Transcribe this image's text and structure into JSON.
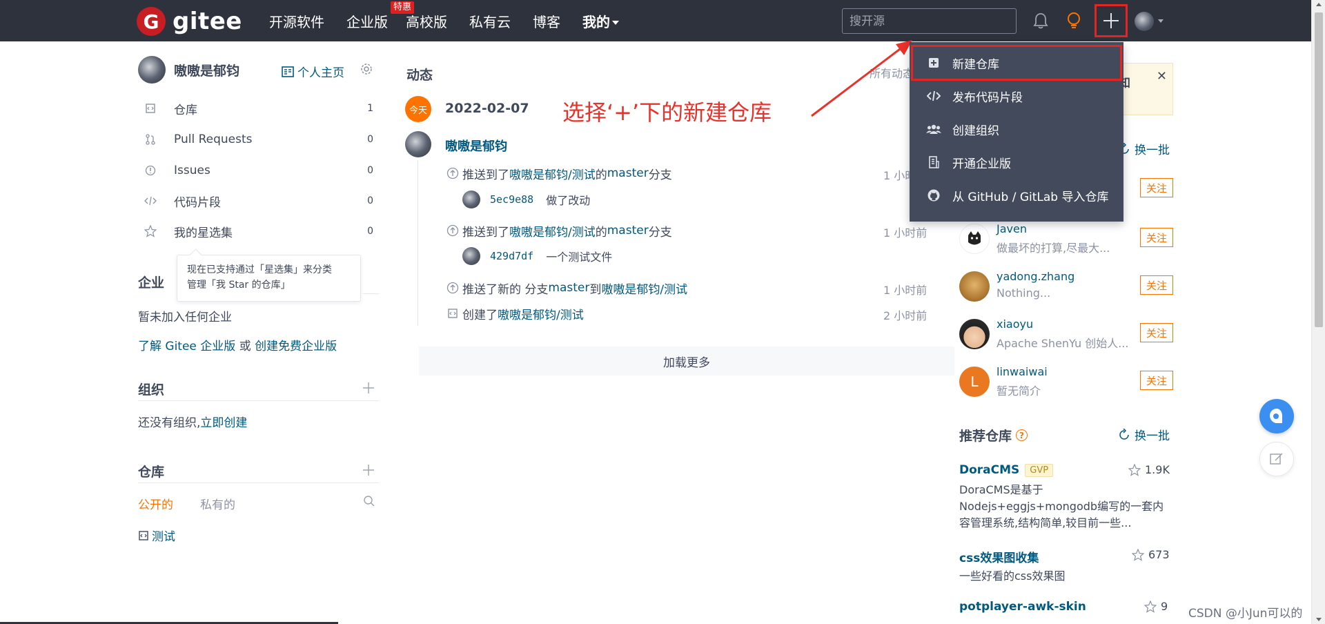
{
  "header": {
    "logo_text": "gitee",
    "logo_letter": "G",
    "nav": [
      {
        "label": "开源软件"
      },
      {
        "label": "企业版",
        "badge": "特惠"
      },
      {
        "label": "高校版"
      },
      {
        "label": "私有云"
      },
      {
        "label": "博客"
      },
      {
        "label": "我的"
      }
    ],
    "search_placeholder": "搜开源"
  },
  "dropdown": {
    "items": [
      {
        "label": "新建仓库",
        "icon": "square-plus-icon"
      },
      {
        "label": "发布代码片段",
        "icon": "code-icon"
      },
      {
        "label": "创建组织",
        "icon": "group-icon"
      },
      {
        "label": "开通企业版",
        "icon": "building-icon"
      },
      {
        "label": "从 GitHub / GitLab 导入仓库",
        "icon": "github-icon"
      }
    ]
  },
  "annotation": {
    "text": "选择‘+’下的新建仓库",
    "color": "#e8322b"
  },
  "sidebar": {
    "user_name": "嗷嗷是郁钧",
    "home_label": "个人主页",
    "menu": [
      {
        "label": "仓库",
        "count": "1"
      },
      {
        "label": "Pull Requests",
        "count": "0"
      },
      {
        "label": "Issues",
        "count": "0"
      },
      {
        "label": "代码片段",
        "count": "0"
      },
      {
        "label": "我的星选集",
        "count": "0"
      }
    ],
    "tooltip_line1": "现在已支持通过「星选集」来分类",
    "tooltip_line2": "管理「我 Star 的仓库」",
    "enterprise": {
      "title": "企业",
      "empty": "暂未加入任何企业",
      "learn_prefix": "了解 Gitee 企业版",
      "or": " 或 ",
      "create_free": "创建免费企业版"
    },
    "org": {
      "title": "组织",
      "empty": "还没有组织,",
      "create_now": "立即创建"
    },
    "repos": {
      "title": "仓库",
      "tab_public": "公开的",
      "tab_private": "私有的",
      "items": [
        "测试"
      ]
    }
  },
  "feed": {
    "title": "动态",
    "all_label": "所有动态",
    "today": "今天",
    "date": "2022-02-07",
    "user": "嗷嗷是郁钧",
    "activities": [
      {
        "pre": "推送到了 ",
        "repo": "嗷嗷是郁钧/测试",
        "mid": " 的 ",
        "branch": "master",
        "post": " 分支",
        "time": "1 小时前",
        "sha": "5ec9e88",
        "msg": "做了改动"
      },
      {
        "pre": "推送到了 ",
        "repo": "嗷嗷是郁钧/测试",
        "mid": " 的 ",
        "branch": "master",
        "post": " 分支",
        "time": "1 小时前",
        "sha": "429d7df",
        "msg": "一个测试文件"
      },
      {
        "pre": "推送了新的 分支 ",
        "repo": "master",
        "mid": " 到 ",
        "branch": "嗷嗷是郁钧/测试",
        "post": "",
        "time": "1 小时前"
      },
      {
        "pre": "创建了 ",
        "repo": "嗷嗷是郁钧/测试",
        "mid": "",
        "branch": "",
        "post": "",
        "time": "2 小时前"
      }
    ],
    "load_more": "加载更多"
  },
  "right": {
    "notice_fragment": "知",
    "refresh_label": "换一批",
    "follow_label": "关注",
    "users": [
      {
        "name": "Javen",
        "desc": "做最坏的打算,尽最大..."
      },
      {
        "name": "yadong.zhang",
        "desc": "Nothing..."
      },
      {
        "name": "xiaoyu",
        "desc": "Apache ShenYu 创始人..."
      },
      {
        "name": "linwaiwai",
        "desc": "暂无简介",
        "initial": "L"
      }
    ],
    "rec_title": "推荐仓库",
    "repos": [
      {
        "name": "DoraCMS",
        "badge": "GVP",
        "stars": "1.9K",
        "desc": "DoraCMS是基于Nodejs+eggjs+mongodb编写的一套内容管理系统,结构简单,较目前一些..."
      },
      {
        "name": "css效果图收集",
        "stars": "673",
        "desc": "一些好看的css效果图"
      },
      {
        "name": "potplayer-awk-skin",
        "stars": "9"
      }
    ]
  },
  "watermark": "CSDN @小Jun可以的",
  "colors": {
    "header_bg": "#2e323d",
    "link": "#005980",
    "accent_orange": "#fe7300",
    "highlight_red": "#e22525"
  }
}
